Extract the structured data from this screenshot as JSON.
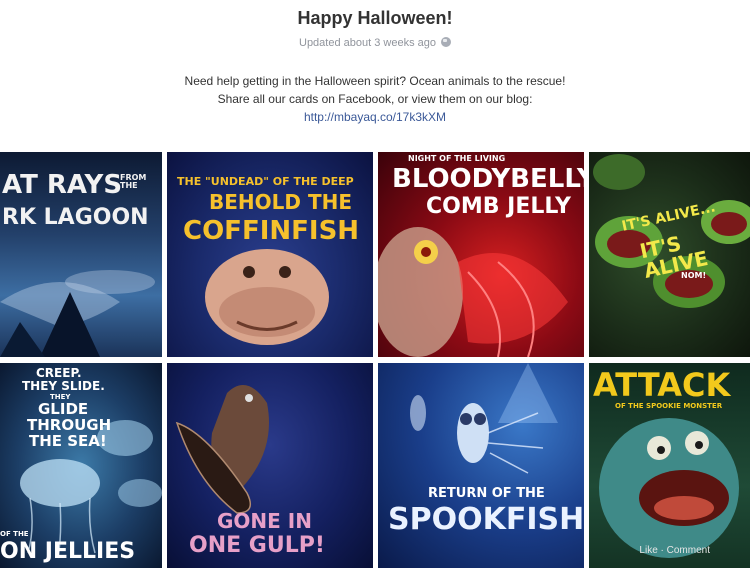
{
  "album": {
    "title": "Happy Halloween!",
    "updated": "Updated about 3 weeks ago",
    "privacy_icon": "globe-icon",
    "description_line1": "Need help getting in the Halloween spirit? Ocean animals to the rescue!",
    "description_line2": "Share all our cards on Facebook, or view them on our blog:",
    "link": "http://mbayaq.co/17k3kXM"
  },
  "photos": [
    {
      "name": "bat-rays-card",
      "caption_line1": "AT RAYS",
      "caption_small": "FROM THE",
      "caption_line2": "RK LAGOON"
    },
    {
      "name": "coffinfish-card",
      "caption_line1": "THE \"UNDEAD\" OF THE DEEP",
      "caption_line2": "BEHOLD THE",
      "caption_line3": "COFFINFISH"
    },
    {
      "name": "comb-jelly-card",
      "caption_small": "NIGHT OF THE LIVING",
      "caption_line1": "BLOODYBELLY",
      "caption_line2": "COMB JELLY"
    },
    {
      "name": "its-alive-card",
      "caption_line1": "IT'S ALIVE...",
      "caption_line2": "IT'S ALIVE",
      "caption_small": "NOM!"
    },
    {
      "name": "moon-jellies-card",
      "caption_line1": "CREEP.",
      "caption_line2": "THEY SLIDE.",
      "caption_small": "THEY",
      "caption_line3": "GLIDE",
      "caption_line4": "THROUGH",
      "caption_line5": "THE SEA!",
      "caption_bottom_small": "OF THE",
      "caption_bottom": "ON JELLIES"
    },
    {
      "name": "gulper-card",
      "caption_line1": "GONE IN",
      "caption_line2": "ONE GULP!"
    },
    {
      "name": "spookfish-card",
      "caption_line1": "RETURN OF THE",
      "caption_line2": "SPOOKFISH"
    },
    {
      "name": "spookie-monster-card",
      "caption_line1": "ATTACK",
      "caption_small": "OF THE SPOOKIE MONSTER",
      "actions": "Like · Comment"
    }
  ],
  "colors": {
    "link": "#3b5998",
    "title": "#333333",
    "meta": "#90949c"
  }
}
